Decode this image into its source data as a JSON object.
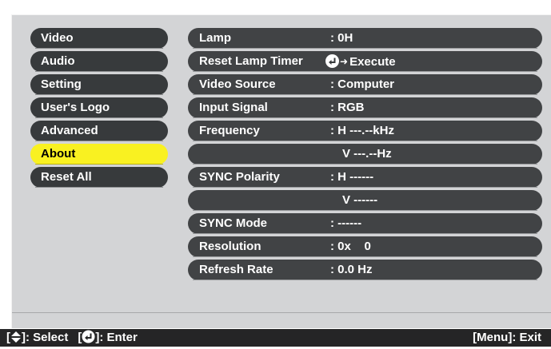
{
  "menu": {
    "items": [
      {
        "label": "Video"
      },
      {
        "label": "Audio"
      },
      {
        "label": "Setting"
      },
      {
        "label": "User's Logo"
      },
      {
        "label": "Advanced"
      },
      {
        "label": "About",
        "selected": true
      },
      {
        "label": "Reset All"
      }
    ]
  },
  "info": {
    "lamp": {
      "label": "Lamp",
      "value": ": 0H"
    },
    "reset_lamp_timer": {
      "label": "Reset Lamp Timer",
      "action": "Execute",
      "icon": "enter-icon"
    },
    "video_source": {
      "label": "Video Source",
      "value": ": Computer"
    },
    "input_signal": {
      "label": "Input Signal",
      "value": ": RGB"
    },
    "frequency": {
      "label": "Frequency",
      "value_h": ": H ---.--kHz",
      "value_v": "V ---.--Hz"
    },
    "sync_polarity": {
      "label": "SYNC Polarity",
      "value_h": ": H ------",
      "value_v": "V ------"
    },
    "sync_mode": {
      "label": "SYNC Mode",
      "value": ": ------"
    },
    "resolution": {
      "label": "Resolution",
      "value": ": 0x    0"
    },
    "refresh_rate": {
      "label": "Refresh Rate",
      "value": ": 0.0 Hz"
    }
  },
  "status_bar": {
    "select_hint": "]: Select",
    "enter_hint": "]: Enter",
    "exit_hint": "[Menu]: Exit",
    "bracket_open": "[",
    "select_icon": "up-down-arrow-icon",
    "enter_icon": "enter-icon"
  },
  "colors": {
    "panel_bg": "#d3d4d6",
    "item_bg": "#373a3c",
    "selected_bg": "#f9f121",
    "status_bar_bg": "#252526"
  }
}
